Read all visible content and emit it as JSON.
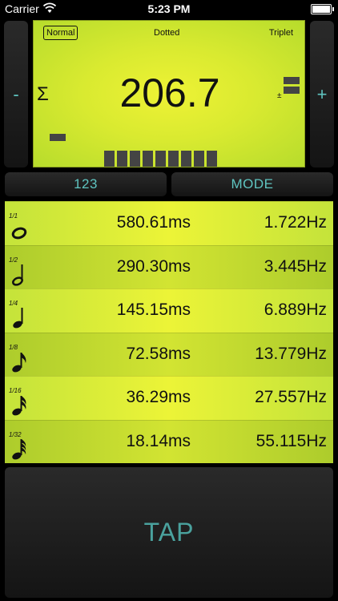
{
  "status": {
    "carrier": "Carrier",
    "time": "5:23 PM"
  },
  "controls": {
    "minus": "-",
    "plus": "+",
    "num_button": "123",
    "mode_button": "MODE",
    "tap": "TAP"
  },
  "lcd": {
    "modes": [
      "Normal",
      "Dotted",
      "Triplet"
    ],
    "selected_mode": "Normal",
    "sigma": "Σ",
    "bpm": "206.7",
    "plusminus": "±",
    "beat_segments": 9
  },
  "notes": [
    {
      "fraction": "1/1",
      "icon": "whole-note-icon",
      "ms": "580.61ms",
      "hz": "1.722Hz"
    },
    {
      "fraction": "1/2",
      "icon": "half-note-icon",
      "ms": "290.30ms",
      "hz": "3.445Hz"
    },
    {
      "fraction": "1/4",
      "icon": "quarter-note-icon",
      "ms": "145.15ms",
      "hz": "6.889Hz"
    },
    {
      "fraction": "1/8",
      "icon": "eighth-note-icon",
      "ms": "72.58ms",
      "hz": "13.779Hz"
    },
    {
      "fraction": "1/16",
      "icon": "sixteenth-note-icon",
      "ms": "36.29ms",
      "hz": "27.557Hz"
    },
    {
      "fraction": "1/32",
      "icon": "thirty-second-note-icon",
      "ms": "18.14ms",
      "hz": "55.115Hz"
    }
  ],
  "colors": {
    "lcd": "#d9ea30",
    "accent": "#5fc4c0",
    "segment": "#444444"
  }
}
